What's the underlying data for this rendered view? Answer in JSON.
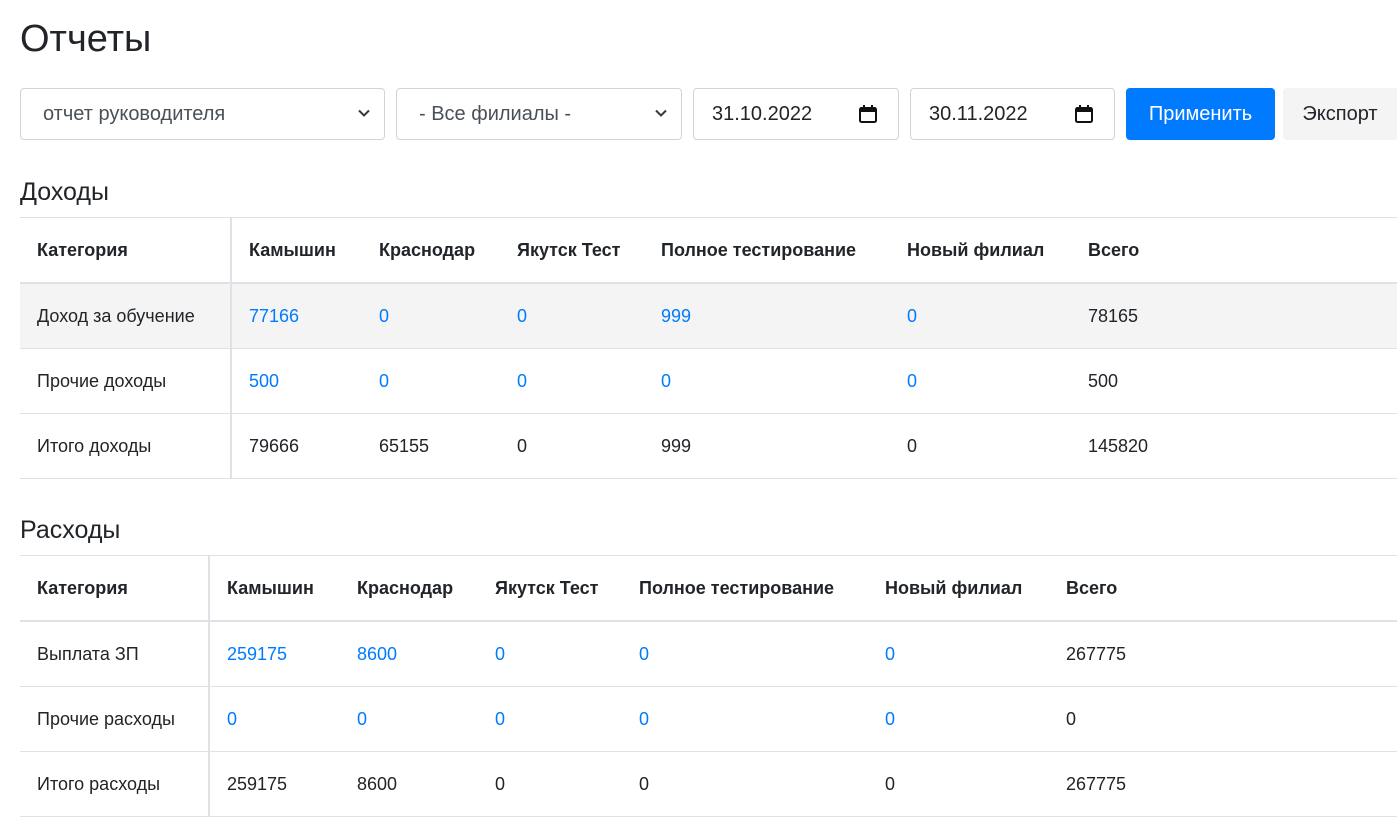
{
  "page": {
    "title": "Отчеты"
  },
  "filters": {
    "report_type": "отчет руководителя",
    "branch": "- Все филиалы -",
    "date_from": "31.10.2022",
    "date_to": "30.11.2022",
    "apply_label": "Применить",
    "export_label": "Экспорт"
  },
  "colors": {
    "accent": "#007bff",
    "link": "#007bff",
    "text": "#212529",
    "row_highlight": "#f4f4f4",
    "border": "#dee2e6"
  },
  "income": {
    "title": "Доходы",
    "headers": [
      "Категория",
      "Камышин",
      "Краснодар",
      "Якутск Тест",
      "Полное тестирование",
      "Новый филиал",
      "Всего"
    ],
    "rows": [
      [
        "Доход за обучение",
        "77166",
        "0",
        "0",
        "999",
        "0",
        "78165"
      ],
      [
        "Прочие доходы",
        "500",
        "0",
        "0",
        "0",
        "0",
        "500"
      ],
      [
        "Итого доходы",
        "79666",
        "65155",
        "0",
        "999",
        "0",
        "145820"
      ]
    ]
  },
  "expenses": {
    "title": "Расходы",
    "headers": [
      "Категория",
      "Камышин",
      "Краснодар",
      "Якутск Тест",
      "Полное тестирование",
      "Новый филиал",
      "Всего"
    ],
    "rows": [
      [
        "Выплата ЗП",
        "259175",
        "8600",
        "0",
        "0",
        "0",
        "267775"
      ],
      [
        "Прочие расходы",
        "0",
        "0",
        "0",
        "0",
        "0",
        "0"
      ],
      [
        "Итого расходы",
        "259175",
        "8600",
        "0",
        "0",
        "0",
        "267775"
      ]
    ]
  },
  "icons": {
    "select_caret": "chevron-down-icon",
    "date_picker": "calendar-icon"
  }
}
